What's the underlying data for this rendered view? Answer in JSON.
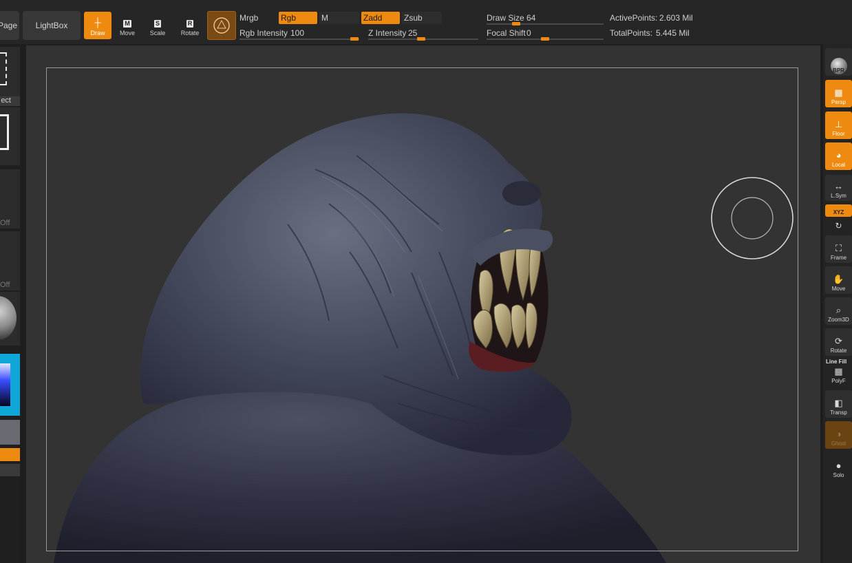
{
  "toolbar": {
    "page_label": "Page",
    "lightbox_label": "LightBox",
    "tools": [
      {
        "label": "Draw",
        "key": "",
        "active": true
      },
      {
        "label": "Move",
        "key": "M",
        "active": false
      },
      {
        "label": "Scale",
        "key": "S",
        "active": false
      },
      {
        "label": "Rotate",
        "key": "R",
        "active": false
      }
    ],
    "mrgb_label": "Mrgb",
    "rgb_label": "Rgb",
    "m_label": "M",
    "zadd_label": "Zadd",
    "zsub_label": "Zsub",
    "rgb_intensity_label": "Rgb Intensity",
    "rgb_intensity_value": "100",
    "z_intensity_label": "Z Intensity",
    "z_intensity_value": "25",
    "draw_size_label": "Draw Size",
    "draw_size_value": "64",
    "focal_shift_label": "Focal Shift",
    "focal_shift_value": "0",
    "active_points_label": "ActivePoints:",
    "active_points_value": "2.603 Mil",
    "total_points_label": "TotalPoints:",
    "total_points_value": "5.445 Mil",
    "accent_color": "#ef8a10"
  },
  "left": {
    "select_label": "ect",
    "off_label_1": "Off",
    "off_label_2": "Off"
  },
  "right": {
    "buttons": [
      {
        "label": "BPR",
        "icon": "sphere-icon",
        "state": "normal"
      },
      {
        "label": "Persp",
        "icon": "grid-perspective-icon",
        "state": "on"
      },
      {
        "label": "Floor",
        "icon": "floor-icon",
        "state": "on"
      },
      {
        "label": "Local",
        "icon": "local-icon",
        "state": "on"
      },
      {
        "label": "L.Sym",
        "icon": "symmetry-icon",
        "state": "normal"
      },
      {
        "label": "XYZ",
        "icon": "xyz-rotate-icon",
        "state": "on"
      },
      {
        "label": "Frame",
        "icon": "frame-icon",
        "state": "normal"
      },
      {
        "label": "Move",
        "icon": "hand-icon",
        "state": "normal"
      },
      {
        "label": "Zoom3D",
        "icon": "zoom-icon",
        "state": "normal"
      },
      {
        "label": "Rotate",
        "icon": "rotate-icon",
        "state": "normal"
      },
      {
        "label": "PolyF",
        "icon": "polyframe-icon",
        "state": "normal"
      },
      {
        "label": "Transp",
        "icon": "transparency-icon",
        "state": "normal"
      },
      {
        "label": "Ghost",
        "icon": "ghost-icon",
        "state": "dim"
      },
      {
        "label": "Solo",
        "icon": "solo-icon",
        "state": "normal"
      }
    ],
    "line_fill_label": "Line Fill"
  }
}
